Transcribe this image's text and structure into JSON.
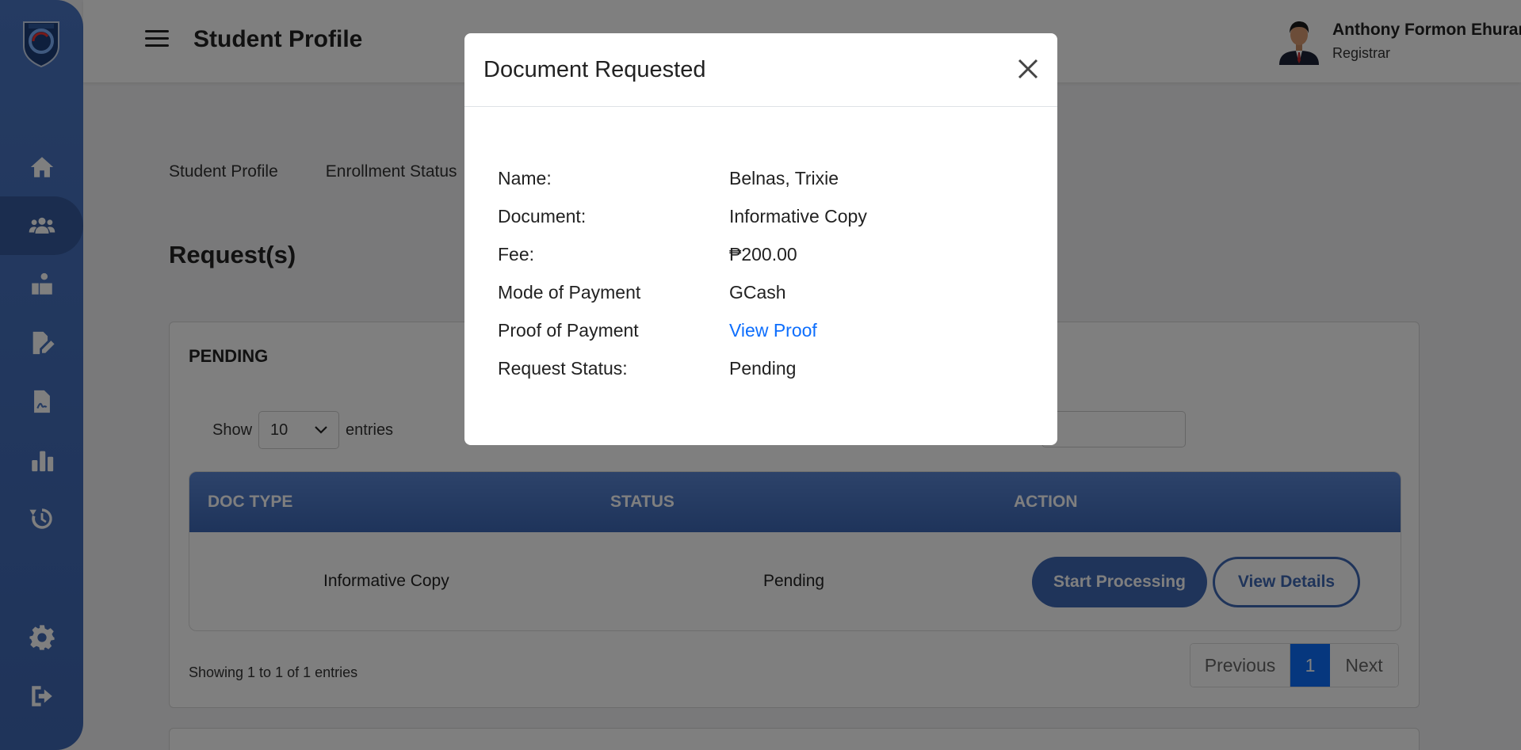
{
  "header": {
    "title": "Student Profile",
    "user_name": "Anthony Formon Ehurango",
    "user_role": "Registrar"
  },
  "sidebar": {
    "items": [
      {
        "icon": "home-icon"
      },
      {
        "icon": "users-icon",
        "active": true
      },
      {
        "icon": "enrollment-icon"
      },
      {
        "icon": "edit-document-icon"
      },
      {
        "icon": "file-signature-icon"
      },
      {
        "icon": "chart-bar-icon"
      },
      {
        "icon": "history-icon"
      },
      {
        "icon": "gear-icon"
      },
      {
        "icon": "logout-icon"
      }
    ]
  },
  "main": {
    "tabs": [
      "Student Profile",
      "Enrollment Status"
    ],
    "section_title": "Request(s)",
    "card_title": "PENDING",
    "show_label": "Show",
    "entries_select": "10",
    "entries_label": "entries",
    "table": {
      "headers": [
        "DOC TYPE",
        "STATUS",
        "ACTION"
      ],
      "rows": [
        {
          "doc_type": "Informative Copy",
          "status": "Pending"
        }
      ],
      "start_button": "Start Processing",
      "details_button": "View Details"
    },
    "showing_text": "Showing 1 to 1 of 1 entries",
    "pagination": {
      "previous": "Previous",
      "current": "1",
      "next": "Next"
    }
  },
  "modal": {
    "title": "Document Requested",
    "rows": [
      {
        "label": "Name:",
        "value": "Belnas, Trixie"
      },
      {
        "label": "Document:",
        "value": "Informative Copy"
      },
      {
        "label": "Fee:",
        "value": "₱200.00"
      },
      {
        "label": "Mode of Payment",
        "value": "GCash"
      },
      {
        "label": "Proof of Payment",
        "value": "View Proof"
      },
      {
        "label": "Request Status:",
        "value": "Pending"
      }
    ]
  },
  "colors": {
    "sidebar": "#4a76c4",
    "primary": "#3f68b4",
    "link": "#0d6efd"
  }
}
